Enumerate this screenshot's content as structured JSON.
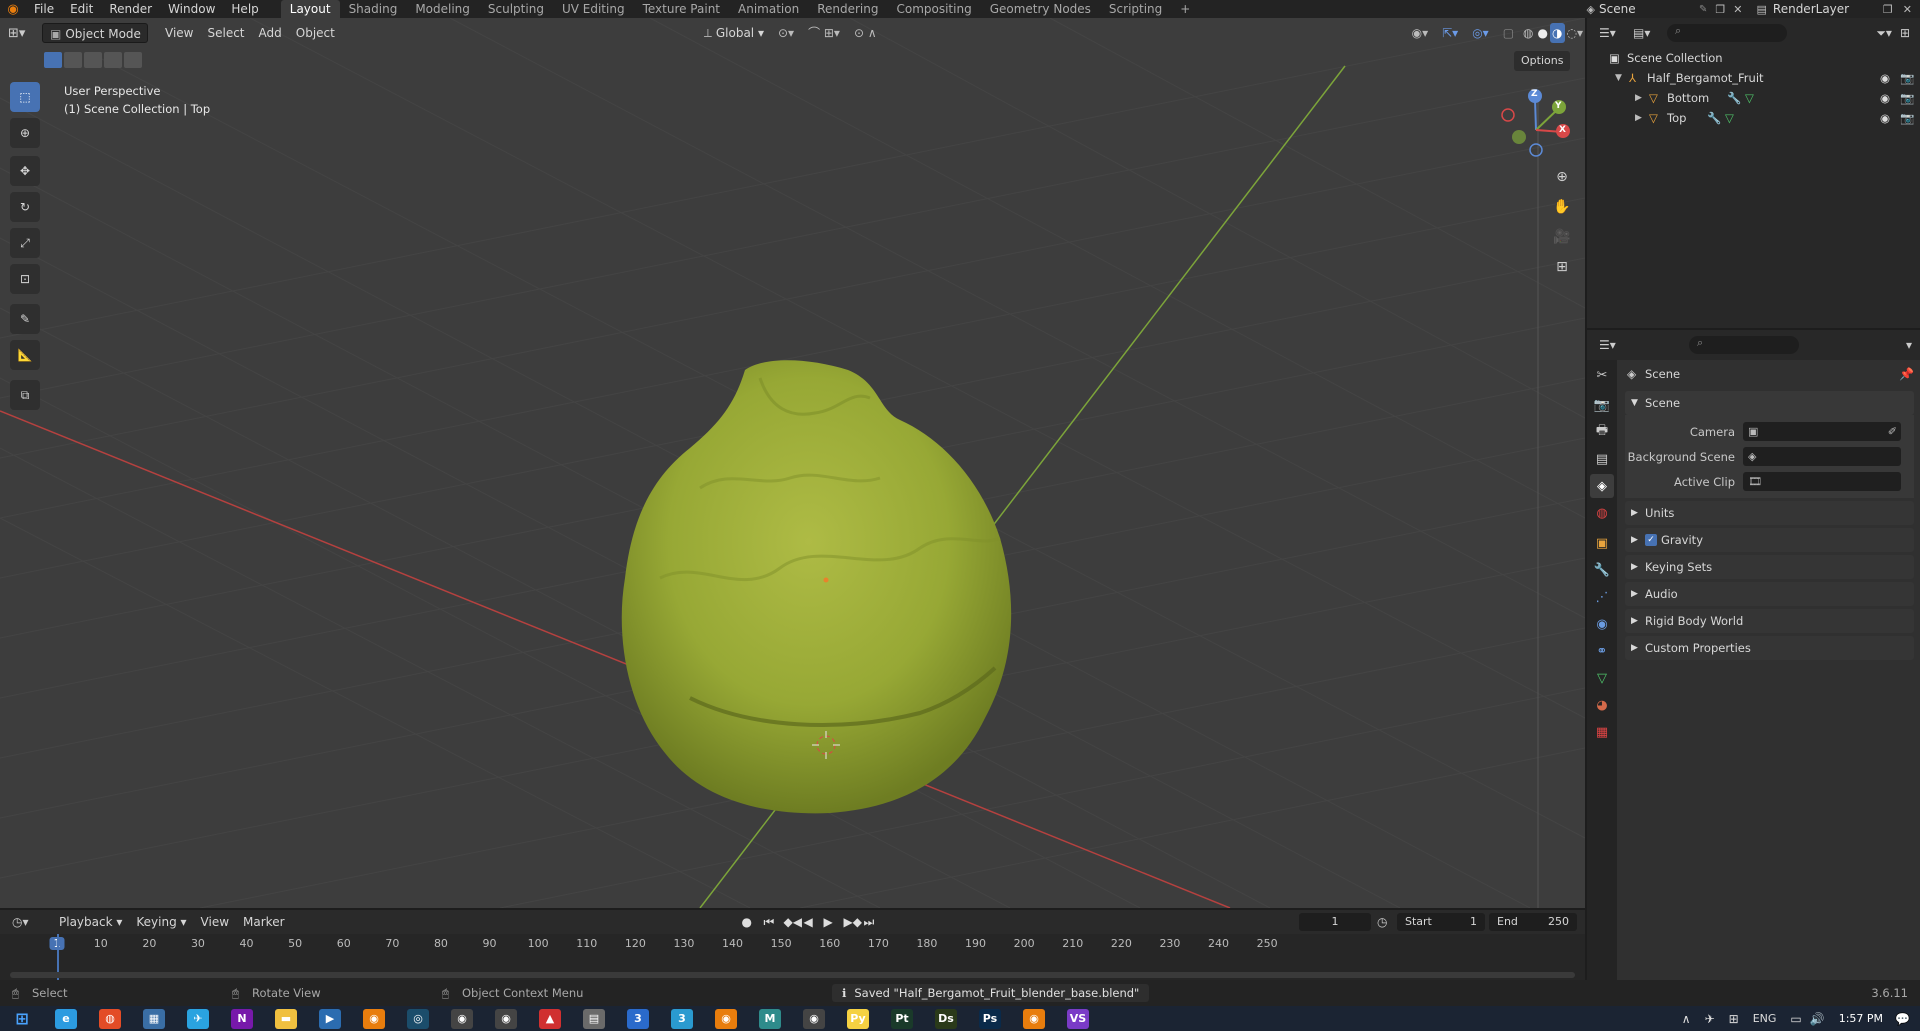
{
  "topbar": {
    "menus": [
      "File",
      "Edit",
      "Render",
      "Window",
      "Help"
    ],
    "workspaces": [
      "Layout",
      "Shading",
      "Modeling",
      "Sculpting",
      "UV Editing",
      "Texture Paint",
      "Animation",
      "Rendering",
      "Compositing",
      "Geometry Nodes",
      "Scripting"
    ],
    "active_workspace": "Layout",
    "add_tab": "+",
    "scene_name": "Scene",
    "render_layer": "RenderLayer"
  },
  "viewport_header": {
    "mode": "Object Mode",
    "menus": [
      "View",
      "Select",
      "Add",
      "Object"
    ],
    "orientation": "Global",
    "options_label": "Options"
  },
  "viewport": {
    "info_line1": "User Perspective",
    "info_line2": "(1) Scene Collection | Top",
    "gizmo": {
      "x": "X",
      "y": "Y",
      "z": "Z"
    }
  },
  "outliner": {
    "root": "Scene Collection",
    "collection": "Half_Bergamot_Fruit",
    "objects": [
      "Bottom",
      "Top"
    ]
  },
  "properties": {
    "context": "Scene",
    "panel_scene": "Scene",
    "camera_label": "Camera",
    "background_scene_label": "Background Scene",
    "active_clip_label": "Active Clip",
    "panels": [
      "Units",
      "Gravity",
      "Keying Sets",
      "Audio",
      "Rigid Body World",
      "Custom Properties"
    ],
    "gravity_checked": true
  },
  "timeline": {
    "menus": [
      "Playback",
      "Keying",
      "View",
      "Marker"
    ],
    "current_frame": "1",
    "start_label": "Start",
    "start_value": "1",
    "end_label": "End",
    "end_value": "250",
    "ruler": [
      "1",
      "10",
      "20",
      "30",
      "40",
      "50",
      "60",
      "70",
      "80",
      "90",
      "100",
      "110",
      "120",
      "130",
      "140",
      "150",
      "160",
      "170",
      "180",
      "190",
      "200",
      "210",
      "220",
      "230",
      "240",
      "250"
    ]
  },
  "statusbar": {
    "select": "Select",
    "rotate": "Rotate View",
    "context_menu": "Object Context Menu",
    "message": "Saved \"Half_Bergamot_Fruit_blender_base.blend\"",
    "version": "3.6.11"
  },
  "taskbar": {
    "apps": [
      "start",
      "edge",
      "chrome",
      "calculator",
      "telegram",
      "onenote",
      "explorer",
      "terminal",
      "blender",
      "steam",
      "obs",
      "obs2",
      "sketchup",
      "files",
      "3ds",
      "3dsmax",
      "blender2",
      "maya",
      "obs3",
      "python",
      "substance-painter",
      "substance-designer",
      "photoshop",
      "blender3",
      "visual-studio"
    ],
    "lang": "ENG",
    "time": "1:57 PM"
  },
  "colors": {
    "accent": "#4772b3",
    "fruit": "#9db03a",
    "x_axis": "#b5413f",
    "y_axis": "#7ca43a"
  }
}
